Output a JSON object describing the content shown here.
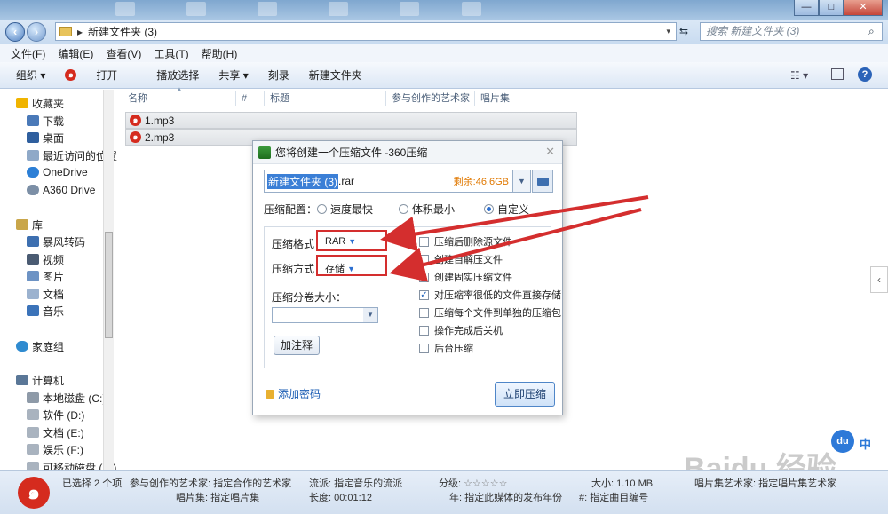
{
  "window": {
    "controls": [
      "—",
      "□",
      "✕"
    ]
  },
  "address": {
    "path": "新建文件夹 (3)",
    "search_placeholder": "搜索 新建文件夹 (3)"
  },
  "menu": [
    "文件(F)",
    "编辑(E)",
    "查看(V)",
    "工具(T)",
    "帮助(H)"
  ],
  "toolbar": {
    "organize": "组织 ▾",
    "open": "打开",
    "play": "播放选择",
    "share": "共享 ▾",
    "burn": "刻录",
    "new_folder": "新建文件夹"
  },
  "sidebar": {
    "favorites": "收藏夹",
    "fav_items": [
      "下载",
      "桌面",
      "最近访问的位置",
      "OneDrive",
      "A360 Drive"
    ],
    "library": "库",
    "lib_items": [
      "暴风转码",
      "视频",
      "图片",
      "文档",
      "音乐"
    ],
    "homegroup": "家庭组",
    "computer": "计算机",
    "drives": [
      "本地磁盘 (C:)",
      "软件 (D:)",
      "文档 (E:)",
      "娱乐 (F:)",
      "可移动磁盘 (H:)"
    ]
  },
  "columns": [
    "名称",
    "#",
    "标题",
    "参与创作的艺术家",
    "唱片集"
  ],
  "files": [
    "1.mp3",
    "2.mp3"
  ],
  "dialog": {
    "title": "您将创建一个压缩文件 -360压缩",
    "filename_sel": "新建文件夹 (3)",
    "filename_ext": ".rar",
    "free_space": "剩余:46.6GB",
    "config_label": "压缩配置：",
    "options": [
      "速度最快",
      "体积最小",
      "自定义"
    ],
    "selected_option": "自定义",
    "format_label": "压缩格式：",
    "format_value": "RAR",
    "method_label": "压缩方式：",
    "method_value": "存储",
    "split_label": "压缩分卷大小：",
    "comment_button": "加注释",
    "checkboxes": [
      {
        "label": "压缩后删除源文件",
        "checked": false
      },
      {
        "label": "创建自解压文件",
        "checked": false
      },
      {
        "label": "创建固实压缩文件",
        "checked": false
      },
      {
        "label": "对压缩率很低的文件直接存储",
        "checked": true
      },
      {
        "label": "压缩每个文件到单独的压缩包",
        "checked": false
      },
      {
        "label": "操作完成后关机",
        "checked": false
      },
      {
        "label": "后台压缩",
        "checked": false
      }
    ],
    "password_link": "添加密码",
    "compress_button": "立即压缩"
  },
  "status": {
    "selected": "已选择 2 个项",
    "artist_label": "参与创作的艺术家:",
    "artist_value": "指定合作的艺术家",
    "genre_label": "流派:",
    "genre_value": "指定音乐的流派",
    "rating_label": "分级:",
    "stars": "☆☆☆☆☆",
    "size_label": "大小:",
    "size_value": "1.10 MB",
    "album_artist_label": "唱片集艺术家:",
    "album_artist_value": "指定唱片集艺术家",
    "album_label": "唱片集:",
    "album_value": "指定唱片集",
    "length_label": "长度:",
    "length_value": "00:01:12",
    "year_label": "年:",
    "year_value": "指定此媒体的发布年份",
    "track_label": "#:",
    "track_value": "指定曲目编号"
  },
  "ime": {
    "badge": "du",
    "lang": "中"
  },
  "watermark": "Baidu 经验",
  "colors": {
    "arrow": "#d42e2e",
    "accent": "#2d6fd0"
  }
}
